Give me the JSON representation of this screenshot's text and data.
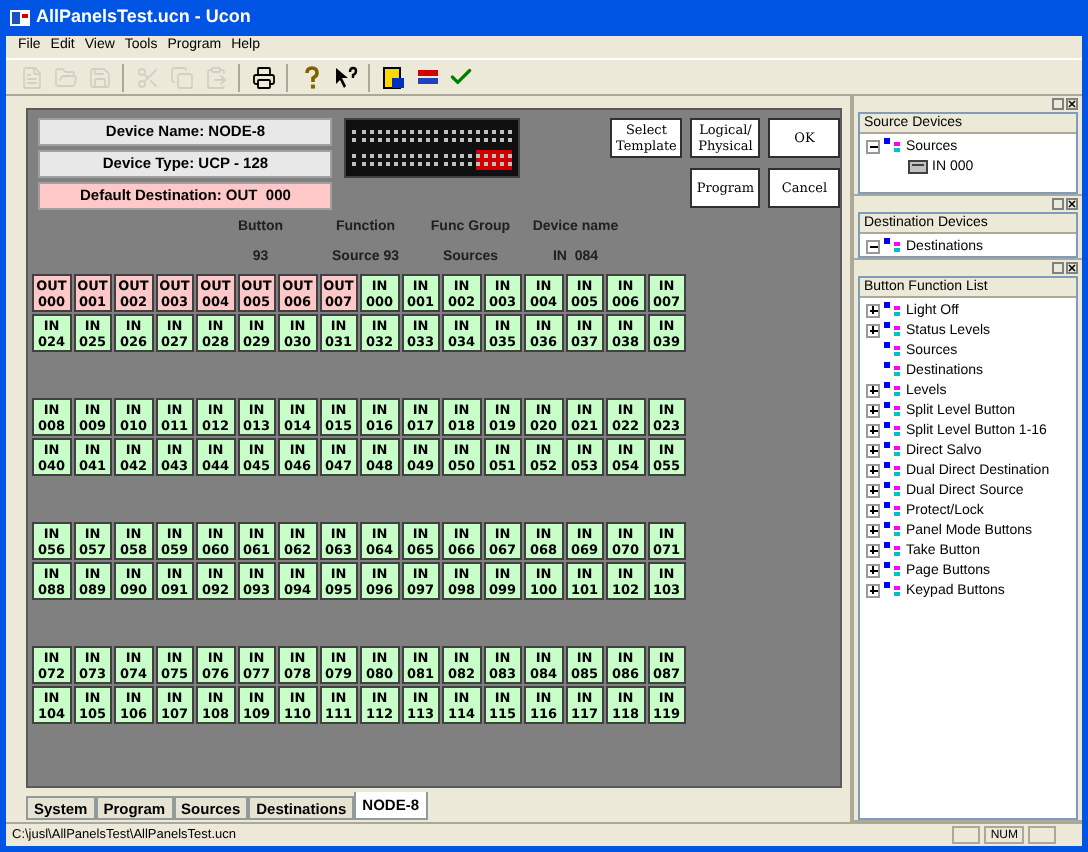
{
  "window": {
    "title": "AllPanelsTest.ucn - Ucon"
  },
  "menu": [
    "File",
    "Edit",
    "View",
    "Tools",
    "Program",
    "Help"
  ],
  "toolbar": [
    {
      "kind": "new",
      "disabled": true
    },
    {
      "kind": "open",
      "disabled": true
    },
    {
      "kind": "save",
      "disabled": true
    },
    {
      "kind": "sep"
    },
    {
      "kind": "cut",
      "disabled": true
    },
    {
      "kind": "copy",
      "disabled": true
    },
    {
      "kind": "paste",
      "disabled": true
    },
    {
      "kind": "sep"
    },
    {
      "kind": "print",
      "disabled": false
    },
    {
      "kind": "sep"
    },
    {
      "kind": "help",
      "disabled": false
    },
    {
      "kind": "context-help",
      "disabled": false
    },
    {
      "kind": "sep"
    },
    {
      "kind": "panel",
      "disabled": false
    },
    {
      "kind": "device",
      "disabled": false
    },
    {
      "kind": "check",
      "disabled": false
    }
  ],
  "device": {
    "name": "Device Name: NODE-8",
    "type": "Device Type: UCP - 128",
    "default_destination": "Default Destination: OUT  000"
  },
  "panel_preview": {
    "blocks": [
      {
        "selected": false
      },
      {
        "selected": false
      },
      {
        "selected": false
      },
      {
        "selected": false
      },
      {
        "selected": false
      },
      {
        "selected": false
      },
      {
        "selected": false
      },
      {
        "selected": true
      }
    ]
  },
  "actions": [
    {
      "label": "Select Template"
    },
    {
      "label": "Logical/ Physical"
    },
    {
      "label": "OK"
    },
    {
      "label": "Program"
    },
    {
      "label": "Cancel"
    }
  ],
  "info": [
    {
      "heading": "Button",
      "value": "93"
    },
    {
      "heading": "Function",
      "value": "Source 93"
    },
    {
      "heading": "Func Group",
      "value": "Sources"
    },
    {
      "heading": "Device name",
      "value": "IN  084"
    }
  ],
  "groups": [
    {
      "rows": [
        [
          {
            "kind": "out",
            "label": "OUT",
            "num": "000"
          },
          {
            "kind": "out",
            "label": "OUT",
            "num": "001"
          },
          {
            "kind": "out",
            "label": "OUT",
            "num": "002"
          },
          {
            "kind": "out",
            "label": "OUT",
            "num": "003"
          },
          {
            "kind": "out",
            "label": "OUT",
            "num": "004"
          },
          {
            "kind": "out",
            "label": "OUT",
            "num": "005"
          },
          {
            "kind": "out",
            "label": "OUT",
            "num": "006"
          },
          {
            "kind": "out",
            "label": "OUT",
            "num": "007"
          },
          {
            "kind": "in",
            "label": "IN",
            "num": "000"
          },
          {
            "kind": "in",
            "label": "IN",
            "num": "001"
          },
          {
            "kind": "in",
            "label": "IN",
            "num": "002"
          },
          {
            "kind": "in",
            "label": "IN",
            "num": "003"
          },
          {
            "kind": "in",
            "label": "IN",
            "num": "004"
          },
          {
            "kind": "in",
            "label": "IN",
            "num": "005"
          },
          {
            "kind": "in",
            "label": "IN",
            "num": "006"
          },
          {
            "kind": "in",
            "label": "IN",
            "num": "007"
          }
        ],
        [
          {
            "kind": "in",
            "label": "IN",
            "num": "024"
          },
          {
            "kind": "in",
            "label": "IN",
            "num": "025"
          },
          {
            "kind": "in",
            "label": "IN",
            "num": "026"
          },
          {
            "kind": "in",
            "label": "IN",
            "num": "027"
          },
          {
            "kind": "in",
            "label": "IN",
            "num": "028"
          },
          {
            "kind": "in",
            "label": "IN",
            "num": "029"
          },
          {
            "kind": "in",
            "label": "IN",
            "num": "030"
          },
          {
            "kind": "in",
            "label": "IN",
            "num": "031"
          },
          {
            "kind": "in",
            "label": "IN",
            "num": "032"
          },
          {
            "kind": "in",
            "label": "IN",
            "num": "033"
          },
          {
            "kind": "in",
            "label": "IN",
            "num": "034"
          },
          {
            "kind": "in",
            "label": "IN",
            "num": "035"
          },
          {
            "kind": "in",
            "label": "IN",
            "num": "036"
          },
          {
            "kind": "in",
            "label": "IN",
            "num": "037"
          },
          {
            "kind": "in",
            "label": "IN",
            "num": "038"
          },
          {
            "kind": "in",
            "label": "IN",
            "num": "039"
          }
        ]
      ]
    },
    {
      "rows": [
        [
          {
            "kind": "in",
            "label": "IN",
            "num": "008"
          },
          {
            "kind": "in",
            "label": "IN",
            "num": "009"
          },
          {
            "kind": "in",
            "label": "IN",
            "num": "010"
          },
          {
            "kind": "in",
            "label": "IN",
            "num": "011"
          },
          {
            "kind": "in",
            "label": "IN",
            "num": "012"
          },
          {
            "kind": "in",
            "label": "IN",
            "num": "013"
          },
          {
            "kind": "in",
            "label": "IN",
            "num": "014"
          },
          {
            "kind": "in",
            "label": "IN",
            "num": "015"
          },
          {
            "kind": "in",
            "label": "IN",
            "num": "016"
          },
          {
            "kind": "in",
            "label": "IN",
            "num": "017"
          },
          {
            "kind": "in",
            "label": "IN",
            "num": "018"
          },
          {
            "kind": "in",
            "label": "IN",
            "num": "019"
          },
          {
            "kind": "in",
            "label": "IN",
            "num": "020"
          },
          {
            "kind": "in",
            "label": "IN",
            "num": "021"
          },
          {
            "kind": "in",
            "label": "IN",
            "num": "022"
          },
          {
            "kind": "in",
            "label": "IN",
            "num": "023"
          }
        ],
        [
          {
            "kind": "in",
            "label": "IN",
            "num": "040"
          },
          {
            "kind": "in",
            "label": "IN",
            "num": "041"
          },
          {
            "kind": "in",
            "label": "IN",
            "num": "042"
          },
          {
            "kind": "in",
            "label": "IN",
            "num": "043"
          },
          {
            "kind": "in",
            "label": "IN",
            "num": "044"
          },
          {
            "kind": "in",
            "label": "IN",
            "num": "045"
          },
          {
            "kind": "in",
            "label": "IN",
            "num": "046"
          },
          {
            "kind": "in",
            "label": "IN",
            "num": "047"
          },
          {
            "kind": "in",
            "label": "IN",
            "num": "048"
          },
          {
            "kind": "in",
            "label": "IN",
            "num": "049"
          },
          {
            "kind": "in",
            "label": "IN",
            "num": "050"
          },
          {
            "kind": "in",
            "label": "IN",
            "num": "051"
          },
          {
            "kind": "in",
            "label": "IN",
            "num": "052"
          },
          {
            "kind": "in",
            "label": "IN",
            "num": "053"
          },
          {
            "kind": "in",
            "label": "IN",
            "num": "054"
          },
          {
            "kind": "in",
            "label": "IN",
            "num": "055"
          }
        ]
      ]
    },
    {
      "rows": [
        [
          {
            "kind": "in",
            "label": "IN",
            "num": "056"
          },
          {
            "kind": "in",
            "label": "IN",
            "num": "057"
          },
          {
            "kind": "in",
            "label": "IN",
            "num": "058"
          },
          {
            "kind": "in",
            "label": "IN",
            "num": "059"
          },
          {
            "kind": "in",
            "label": "IN",
            "num": "060"
          },
          {
            "kind": "in",
            "label": "IN",
            "num": "061"
          },
          {
            "kind": "in",
            "label": "IN",
            "num": "062"
          },
          {
            "kind": "in",
            "label": "IN",
            "num": "063"
          },
          {
            "kind": "in",
            "label": "IN",
            "num": "064"
          },
          {
            "kind": "in",
            "label": "IN",
            "num": "065"
          },
          {
            "kind": "in",
            "label": "IN",
            "num": "066"
          },
          {
            "kind": "in",
            "label": "IN",
            "num": "067"
          },
          {
            "kind": "in",
            "label": "IN",
            "num": "068"
          },
          {
            "kind": "in",
            "label": "IN",
            "num": "069"
          },
          {
            "kind": "in",
            "label": "IN",
            "num": "070"
          },
          {
            "kind": "in",
            "label": "IN",
            "num": "071"
          }
        ],
        [
          {
            "kind": "in",
            "label": "IN",
            "num": "088"
          },
          {
            "kind": "in",
            "label": "IN",
            "num": "089"
          },
          {
            "kind": "in",
            "label": "IN",
            "num": "090"
          },
          {
            "kind": "in",
            "label": "IN",
            "num": "091"
          },
          {
            "kind": "in",
            "label": "IN",
            "num": "092"
          },
          {
            "kind": "in",
            "label": "IN",
            "num": "093"
          },
          {
            "kind": "in",
            "label": "IN",
            "num": "094"
          },
          {
            "kind": "in",
            "label": "IN",
            "num": "095"
          },
          {
            "kind": "in",
            "label": "IN",
            "num": "096"
          },
          {
            "kind": "in",
            "label": "IN",
            "num": "097"
          },
          {
            "kind": "in",
            "label": "IN",
            "num": "098"
          },
          {
            "kind": "in",
            "label": "IN",
            "num": "099"
          },
          {
            "kind": "in",
            "label": "IN",
            "num": "100"
          },
          {
            "kind": "in",
            "label": "IN",
            "num": "101"
          },
          {
            "kind": "in",
            "label": "IN",
            "num": "102"
          },
          {
            "kind": "in",
            "label": "IN",
            "num": "103"
          }
        ]
      ]
    },
    {
      "rows": [
        [
          {
            "kind": "in",
            "label": "IN",
            "num": "072"
          },
          {
            "kind": "in",
            "label": "IN",
            "num": "073"
          },
          {
            "kind": "in",
            "label": "IN",
            "num": "074"
          },
          {
            "kind": "in",
            "label": "IN",
            "num": "075"
          },
          {
            "kind": "in",
            "label": "IN",
            "num": "076"
          },
          {
            "kind": "in",
            "label": "IN",
            "num": "077"
          },
          {
            "kind": "in",
            "label": "IN",
            "num": "078"
          },
          {
            "kind": "in",
            "label": "IN",
            "num": "079"
          },
          {
            "kind": "in",
            "label": "IN",
            "num": "080"
          },
          {
            "kind": "in",
            "label": "IN",
            "num": "081"
          },
          {
            "kind": "in",
            "label": "IN",
            "num": "082"
          },
          {
            "kind": "in",
            "label": "IN",
            "num": "083"
          },
          {
            "kind": "in",
            "label": "IN",
            "num": "084"
          },
          {
            "kind": "in",
            "label": "IN",
            "num": "085"
          },
          {
            "kind": "in",
            "label": "IN",
            "num": "086"
          },
          {
            "kind": "in",
            "label": "IN",
            "num": "087"
          }
        ],
        [
          {
            "kind": "in",
            "label": "IN",
            "num": "104"
          },
          {
            "kind": "in",
            "label": "IN",
            "num": "105"
          },
          {
            "kind": "in",
            "label": "IN",
            "num": "106"
          },
          {
            "kind": "in",
            "label": "IN",
            "num": "107"
          },
          {
            "kind": "in",
            "label": "IN",
            "num": "108"
          },
          {
            "kind": "in",
            "label": "IN",
            "num": "109"
          },
          {
            "kind": "in",
            "label": "IN",
            "num": "110"
          },
          {
            "kind": "in",
            "label": "IN",
            "num": "111"
          },
          {
            "kind": "in",
            "label": "IN",
            "num": "112"
          },
          {
            "kind": "in",
            "label": "IN",
            "num": "113"
          },
          {
            "kind": "in",
            "label": "IN",
            "num": "114"
          },
          {
            "kind": "in",
            "label": "IN",
            "num": "115"
          },
          {
            "kind": "in",
            "label": "IN",
            "num": "116"
          },
          {
            "kind": "in",
            "label": "IN",
            "num": "117"
          },
          {
            "kind": "in",
            "label": "IN",
            "num": "118"
          },
          {
            "kind": "in",
            "label": "IN",
            "num": "119"
          }
        ]
      ]
    }
  ],
  "tabs": [
    {
      "label": "System",
      "selected": false
    },
    {
      "label": "Program",
      "selected": false
    },
    {
      "label": "Sources",
      "selected": false
    },
    {
      "label": "Destinations",
      "selected": false
    },
    {
      "label": "NODE-8",
      "selected": true
    }
  ],
  "source_devices": {
    "title": "Source Devices",
    "items": [
      {
        "label": "Sources",
        "kind": "folder",
        "expanded": true,
        "children": [
          {
            "label": "IN  000",
            "kind": "device"
          }
        ]
      }
    ]
  },
  "destination_devices": {
    "title": "Destination Devices",
    "items": [
      {
        "label": "Destinations",
        "kind": "folder",
        "expanded": true
      }
    ]
  },
  "button_functions": {
    "title": "Button Function List",
    "items": [
      {
        "label": "Light Off",
        "kind": "folder",
        "expanded": false
      },
      {
        "label": "Status Levels",
        "kind": "folder",
        "expanded": false
      },
      {
        "label": "Sources",
        "kind": "leaf"
      },
      {
        "label": "Destinations",
        "kind": "leaf"
      },
      {
        "label": "Levels",
        "kind": "folder",
        "expanded": false
      },
      {
        "label": "Split Level Button",
        "kind": "folder",
        "expanded": false
      },
      {
        "label": "Split Level Button 1-16",
        "kind": "folder",
        "expanded": false
      },
      {
        "label": "Direct Salvo",
        "kind": "folder",
        "expanded": false
      },
      {
        "label": "Dual Direct Destination",
        "kind": "folder",
        "expanded": false
      },
      {
        "label": "Dual Direct Source",
        "kind": "folder",
        "expanded": false
      },
      {
        "label": "Protect/Lock",
        "kind": "folder",
        "expanded": false
      },
      {
        "label": "Panel Mode Buttons",
        "kind": "folder",
        "expanded": false
      },
      {
        "label": "Take Button",
        "kind": "folder",
        "expanded": false
      },
      {
        "label": "Page Buttons",
        "kind": "folder",
        "expanded": false
      },
      {
        "label": "Keypad Buttons",
        "kind": "folder",
        "expanded": false
      }
    ]
  },
  "status_bar": {
    "path": "C:\\jusl\\AllPanelsTest\\AllPanelsTest.ucn",
    "indicators": [
      "NUM"
    ]
  }
}
